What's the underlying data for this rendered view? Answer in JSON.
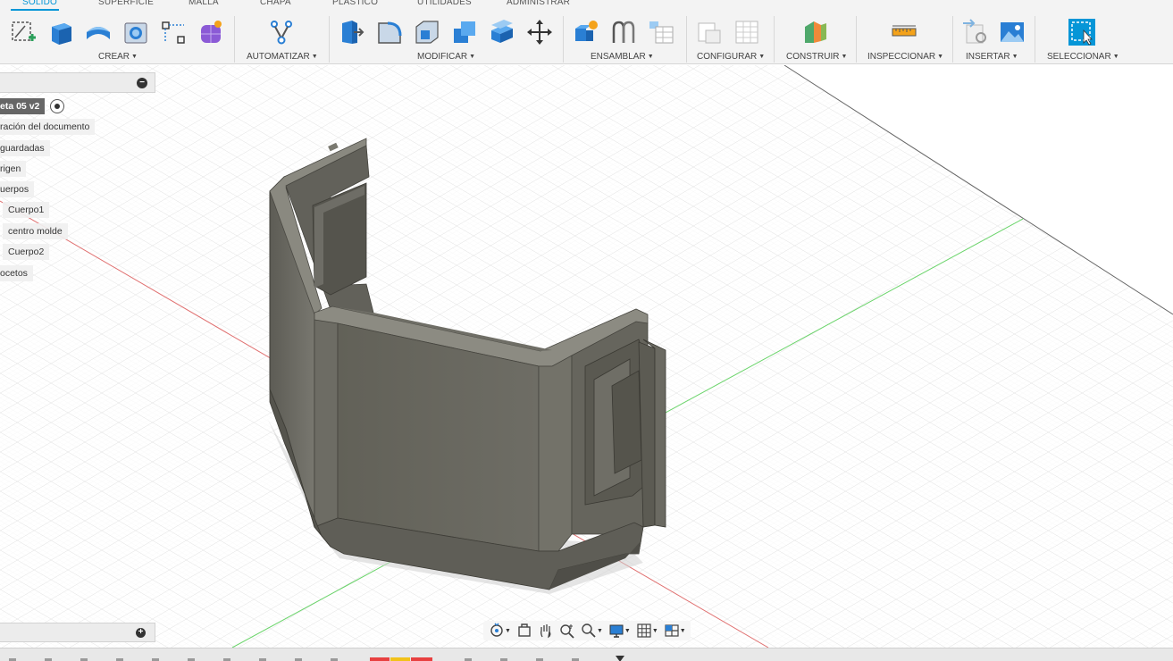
{
  "tabs": [
    {
      "label": "SÓLIDO",
      "active": true
    },
    {
      "label": "SUPERFICIE"
    },
    {
      "label": "MALLA"
    },
    {
      "label": "CHAPA"
    },
    {
      "label": "PLÁSTICO"
    },
    {
      "label": "UTILIDADES"
    },
    {
      "label": "ADMINISTRAR"
    }
  ],
  "toolbar": {
    "groups": [
      {
        "label": "CREAR",
        "icons": [
          "create-sketch-icon",
          "extrude-icon",
          "revolve-icon",
          "hole-icon",
          "sketch-dimension-icon",
          "form-icon"
        ]
      },
      {
        "label": "AUTOMATIZAR",
        "icons": [
          "automate-icon"
        ]
      },
      {
        "label": "MODIFICAR",
        "icons": [
          "press-pull-icon",
          "fillet-icon",
          "shell-icon",
          "combine-icon",
          "offset-face-icon",
          "move-icon"
        ]
      },
      {
        "label": "ENSAMBLAR",
        "icons": [
          "new-component-icon",
          "joint-icon",
          "table-icon"
        ]
      },
      {
        "label": "CONFIGURAR",
        "icons": [
          "configure-icon",
          "configure-table-icon"
        ]
      },
      {
        "label": "CONSTRUIR",
        "icons": [
          "construct-plane-icon"
        ]
      },
      {
        "label": "INSPECCIONAR",
        "icons": [
          "measure-icon"
        ]
      },
      {
        "label": "INSERTAR",
        "icons": [
          "insert-derive-icon",
          "insert-image-icon"
        ]
      },
      {
        "label": "SELECCIONAR",
        "icons": [
          "select-icon"
        ]
      }
    ]
  },
  "browser": {
    "root_label": "eta 05 v2",
    "items": [
      {
        "label": "ración del documento"
      },
      {
        "label": "guardadas"
      },
      {
        "label": "rigen"
      },
      {
        "label": "uerpos"
      },
      {
        "label": "Cuerpo1"
      },
      {
        "label": "centro molde"
      },
      {
        "label": "Cuerpo2"
      },
      {
        "label": "ocetos"
      }
    ],
    "collapse_icon": "minus-icon"
  },
  "comments": {
    "icon": "plus-icon"
  },
  "navbar": {
    "icons": [
      "orbit-icon",
      "look-at-icon",
      "pan-icon",
      "zoom-icon",
      "zoom-window-icon",
      "display-settings-icon",
      "grid-icon",
      "viewports-icon"
    ]
  },
  "colors": {
    "accent": "#0696d7",
    "model": "#6b6a62",
    "grid": "#dcdcdc",
    "x_axis": "#e05050",
    "z_axis": "#4fcf4f"
  }
}
